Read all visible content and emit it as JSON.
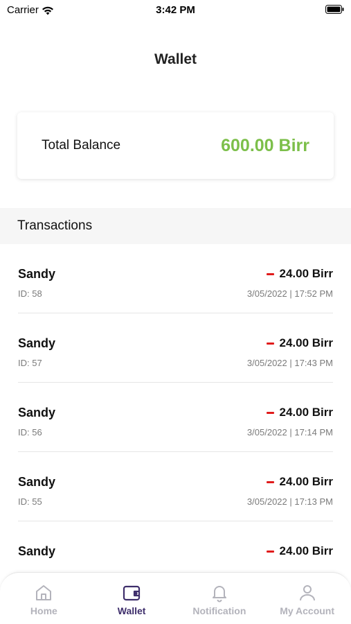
{
  "status_bar": {
    "carrier": "Carrier",
    "time": "3:42 PM"
  },
  "header": {
    "title": "Wallet"
  },
  "balance": {
    "label": "Total Balance",
    "value": "600.00 Birr",
    "value_color": "#7cbf4a"
  },
  "transactions": {
    "section_title": "Transactions",
    "items": [
      {
        "name": "Sandy",
        "id": "ID: 58",
        "amount": "24.00 Birr",
        "date": "3/05/2022 | 17:52 PM"
      },
      {
        "name": "Sandy",
        "id": "ID: 57",
        "amount": "24.00 Birr",
        "date": "3/05/2022 | 17:43 PM"
      },
      {
        "name": "Sandy",
        "id": "ID: 56",
        "amount": "24.00 Birr",
        "date": "3/05/2022 | 17:14 PM"
      },
      {
        "name": "Sandy",
        "id": "ID: 55",
        "amount": "24.00 Birr",
        "date": "3/05/2022 | 17:13 PM"
      },
      {
        "name": "Sandy",
        "id": "",
        "amount": "24.00 Birr",
        "date": ""
      }
    ],
    "debit_color": "#e01b1b"
  },
  "tab_bar": {
    "active_color": "#3e2e6b",
    "inactive_color": "#b3b3bb",
    "tabs": [
      {
        "label": "Home",
        "icon": "home-icon"
      },
      {
        "label": "Wallet",
        "icon": "wallet-icon"
      },
      {
        "label": "Notification",
        "icon": "bell-icon"
      },
      {
        "label": "My Account",
        "icon": "user-icon"
      }
    ]
  }
}
